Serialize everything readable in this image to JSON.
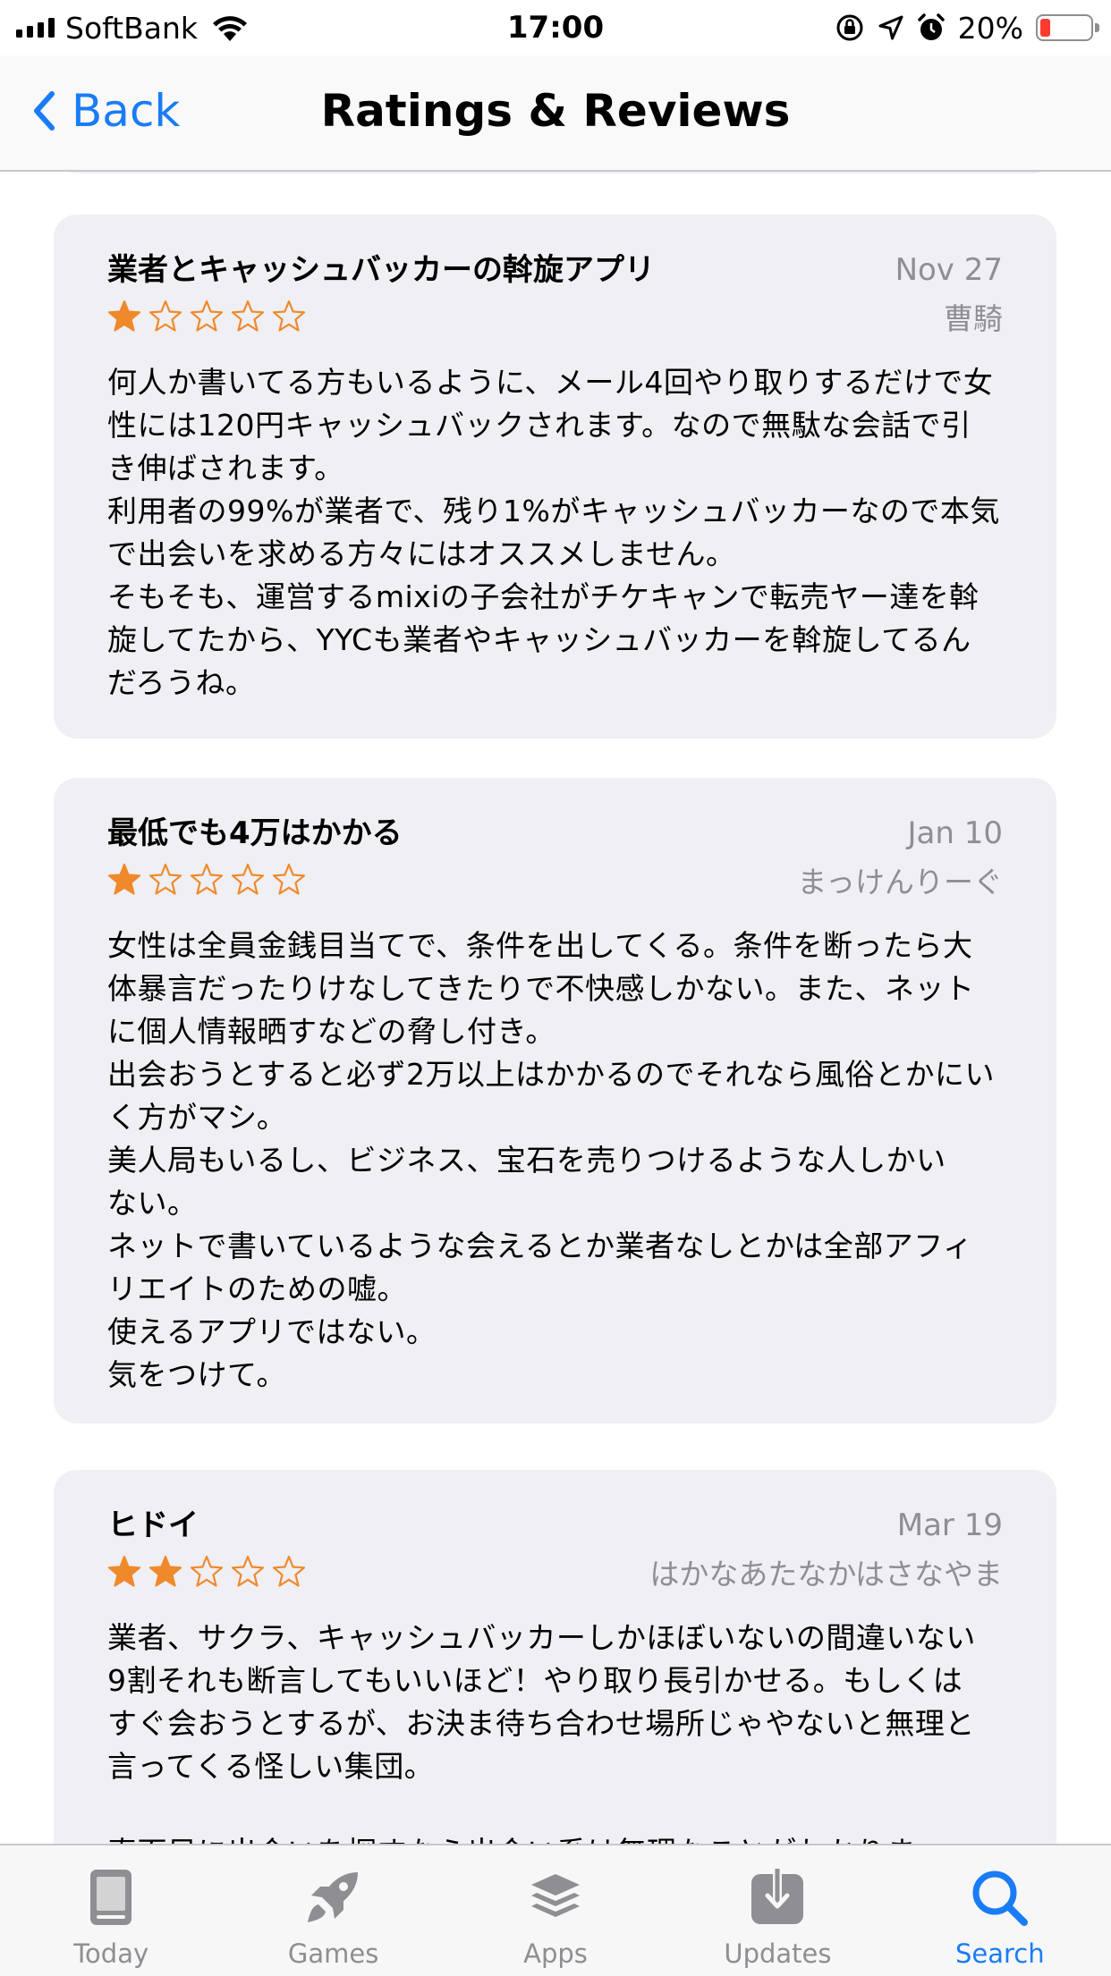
{
  "status_bar": {
    "carrier": "SoftBank",
    "time": "17:00",
    "battery_percent": "20%",
    "battery_level": 0.2
  },
  "nav": {
    "back_label": "Back",
    "title": "Ratings & Reviews"
  },
  "reviews": [
    {
      "title": "業者とキャッシュバッカーの斡旋アプリ",
      "date": "Nov 27",
      "author": "曹騎",
      "rating": 1,
      "body": "何人か書いてる方もいるように、メール4回やり取りするだけで女\n性には120円キャッシュバックされます。なので無駄な会話で引\nき伸ばされます。\n利用者の99%が業者で、残り1%がキャッシュバッカーなので本気\nで出会いを求める方々にはオススメしません。\nそもそも、運営するmixiの子会社がチケキャンで転売ヤー達を斡\n旋してたから、YYCも業者やキャッシュバッカーを斡旋してるん\nだろうね。"
    },
    {
      "title": "最低でも4万はかかる",
      "date": "Jan 10",
      "author": "まっけんりーぐ",
      "rating": 1,
      "body": "女性は全員金銭目当てで、条件を出してくる。条件を断ったら大\n体暴言だったりけなしてきたりで不快感しかない。また、ネット\nに個人情報晒すなどの脅し付き。\n出会おうとすると必ず2万以上はかかるのでそれなら風俗とかにい\nく方がマシ。\n美人局もいるし、ビジネス、宝石を売りつけるような人しかい\nない。\nネットで書いているような会えるとか業者なしとかは全部アフィ\nリエイトのための嘘。\n使えるアプリではない。\n気をつけて。"
    },
    {
      "title": "ヒドイ",
      "date": "Mar 19",
      "author": "はかなあたなかはさなやま",
      "rating": 2,
      "body": "業者、サクラ、キャッシュバッカーしかほぼいないの間違いない\n9割それも断言してもいいほど！やり取り長引かせる。もしくは\nすぐ会おうとするが、お決ま待ち合わせ場所じゃやないと無理と\n言ってくる怪しい集団。\n\n真面目に出会いを探すなら出会い系は無理なことがわかりま"
    }
  ],
  "tabs": [
    {
      "label": "Today",
      "icon": "today-icon",
      "active": false
    },
    {
      "label": "Games",
      "icon": "rocket-icon",
      "active": false
    },
    {
      "label": "Apps",
      "icon": "layers-icon",
      "active": false
    },
    {
      "label": "Updates",
      "icon": "download-icon",
      "active": false
    },
    {
      "label": "Search",
      "icon": "search-icon",
      "active": true
    }
  ],
  "colors": {
    "accent": "#1a7cf5",
    "star": "#f0892b",
    "card_bg": "#efeff4",
    "secondary_text": "#8e8e93",
    "battery_low": "#ff3b30"
  }
}
